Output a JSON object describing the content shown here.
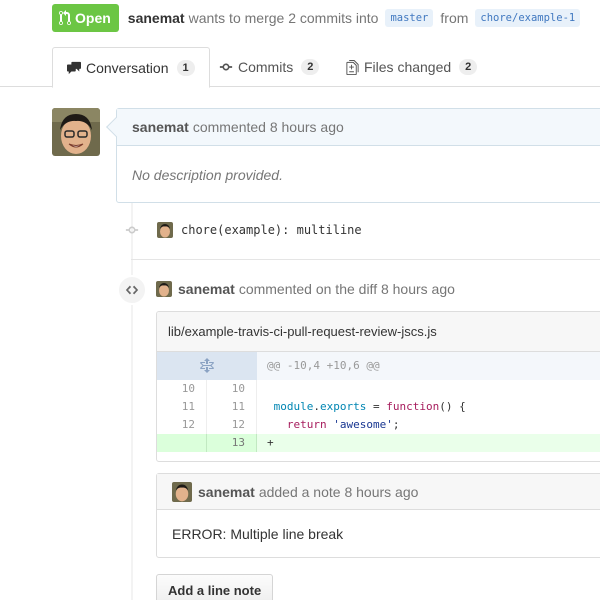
{
  "pr": {
    "state": "Open",
    "author": "sanemat",
    "merge_text": "wants to merge 2 commits into",
    "base_branch": "master",
    "from_text": "from",
    "head_branch": "chore/example-1"
  },
  "tabs": [
    {
      "label": "Conversation",
      "count": "1"
    },
    {
      "label": "Commits",
      "count": "2"
    },
    {
      "label": "Files changed",
      "count": "2"
    }
  ],
  "comment": {
    "author": "sanemat",
    "action": "commented 8 hours ago",
    "body": "No description provided."
  },
  "commit": {
    "message": "chore(example): multiline"
  },
  "diff_comment": {
    "author": "sanemat",
    "action": "commented on the diff 8 hours ago",
    "file": "lib/example-travis-ci-pull-request-review-jscs.js",
    "hunk": "@@ -10,4 +10,6 @@",
    "lines": [
      {
        "old": "10",
        "new": "10",
        "tokens": []
      },
      {
        "old": "11",
        "new": "11",
        "tokens": [
          [
            "",
            " "
          ],
          [
            "kw",
            "module"
          ],
          [
            "",
            "."
          ],
          [
            "kw",
            "exports"
          ],
          [
            "",
            " = "
          ],
          [
            "fn",
            "function"
          ],
          [
            "",
            "() {"
          ]
        ]
      },
      {
        "old": "12",
        "new": "12",
        "tokens": [
          [
            "",
            "   "
          ],
          [
            "fn",
            "return"
          ],
          [
            "",
            " "
          ],
          [
            "str",
            "'awesome'"
          ],
          [
            "",
            ";"
          ]
        ]
      },
      {
        "old": "",
        "new": "13",
        "tokens": [
          [
            "",
            "+"
          ]
        ],
        "added": true
      }
    ]
  },
  "note": {
    "author": "sanemat",
    "action": "added a note 8 hours ago",
    "body": "ERROR: Multiple line break"
  },
  "buttons": {
    "add_line_note": "Add a line note"
  },
  "colors": {
    "open_green": "#6cc644",
    "link_blue": "#4078c0",
    "added_bg": "#eaffea"
  },
  "icons": [
    "git-pull-request-icon",
    "comment-discussion-icon",
    "git-commit-icon",
    "diff-icon",
    "unfold-icon",
    "code-icon"
  ]
}
